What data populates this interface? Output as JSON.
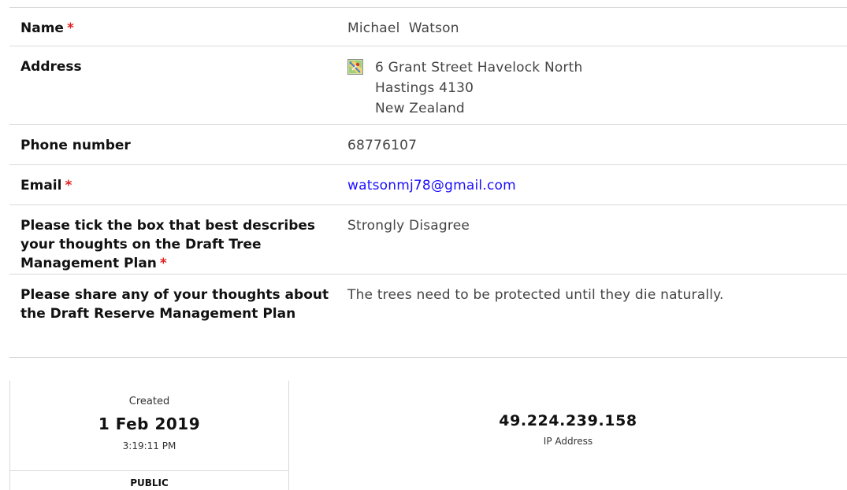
{
  "fields": {
    "name": {
      "label": "Name",
      "required_mark": "*",
      "value": "Michael  Watson"
    },
    "address": {
      "label": "Address",
      "icon": "map-icon",
      "lines": [
        "6 Grant Street Havelock North",
        "Hastings 4130",
        "New Zealand"
      ]
    },
    "phone": {
      "label": "Phone number",
      "value": "68776107"
    },
    "email": {
      "label": "Email",
      "required_mark": "*",
      "value": "watsonmj78@gmail.com"
    },
    "tick": {
      "label": "Please tick the box that best describes your thoughts on the Draft Tree Management Plan",
      "required_mark": "*",
      "value": "Strongly Disagree"
    },
    "thoughts": {
      "label": "Please share any of your thoughts about the Draft Reserve Management Plan",
      "value": "The trees need to be protected until they die naturally."
    }
  },
  "meta": {
    "created_label": "Created",
    "created_date": "1 Feb 2019",
    "created_time": "3:19:11 PM",
    "visibility": "PUBLIC",
    "ip": "49.224.239.158",
    "ip_label": "IP Address"
  },
  "colors": {
    "required": "#e02020",
    "link": "#1a0dff",
    "divider": "#d9d9d9"
  }
}
